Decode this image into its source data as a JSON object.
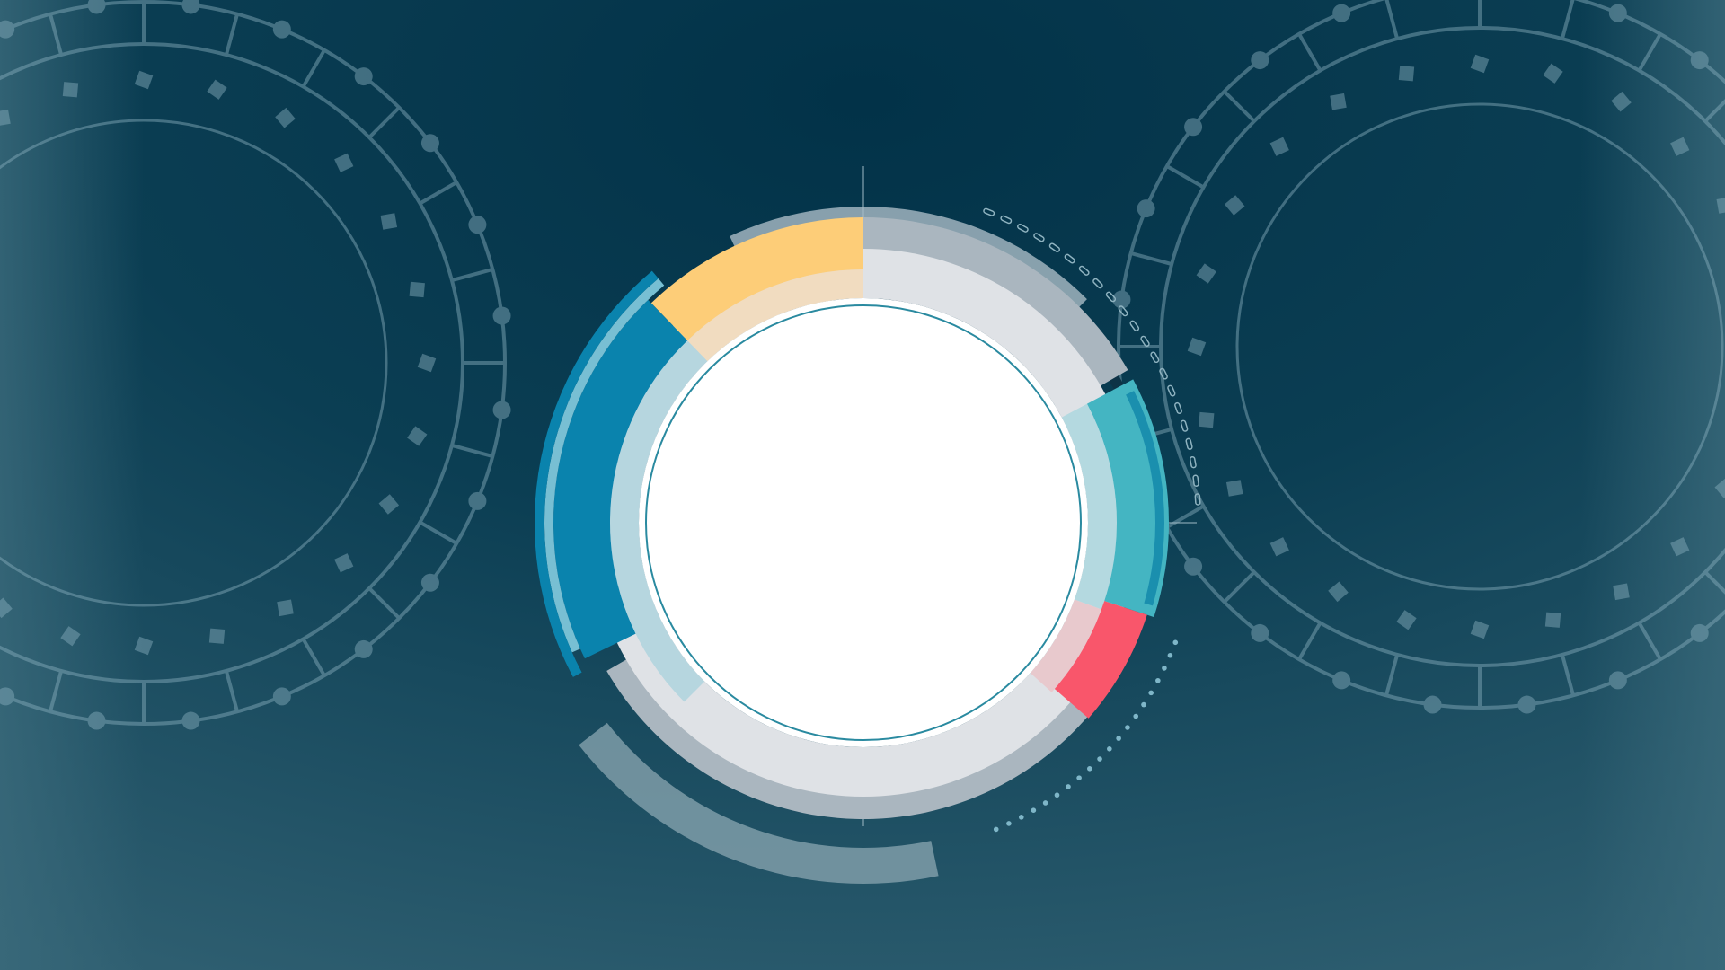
{
  "colors": {
    "background_top": "#033348",
    "background_bottom": "#2d5d6f",
    "yellow": "#fdcd78",
    "blue": "#0a83ad",
    "teal": "#44b5c2",
    "red": "#f9566b",
    "gray_ring": "#c9d3d9",
    "light_gray": "#dfe2e6",
    "outline": "#5f8797",
    "center": "#ffffff"
  },
  "segments": [
    {
      "name": "yellow",
      "share": 12
    },
    {
      "name": "blue",
      "share": 21
    },
    {
      "name": "teal",
      "share": 13
    },
    {
      "name": "red",
      "share": 6
    }
  ]
}
